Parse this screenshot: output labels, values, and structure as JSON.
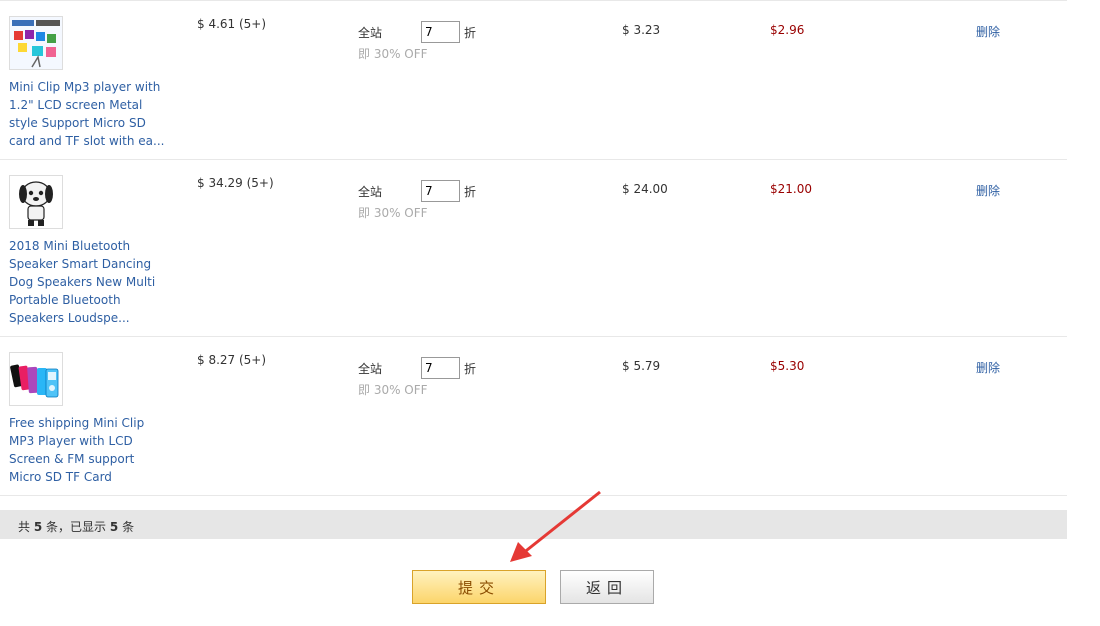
{
  "rows": [
    {
      "title": "Mini Clip Mp3 player with 1.2\" LCD screen Metal style Support Micro SD card and TF slot with ea...",
      "price": "$ 4.61 (5+)",
      "site_label": "全站",
      "discount_value": "7",
      "zhe": "折",
      "off": "即 30% OFF",
      "new_price": "$ 3.23",
      "final_price": "$2.96",
      "delete": "删除"
    },
    {
      "title": "2018 Mini Bluetooth Speaker Smart Dancing Dog Speakers New Multi Portable Bluetooth Speakers Loudspe...",
      "price": "$ 34.29 (5+)",
      "site_label": "全站",
      "discount_value": "7",
      "zhe": "折",
      "off": "即 30% OFF",
      "new_price": "$ 24.00",
      "final_price": "$21.00",
      "delete": "删除"
    },
    {
      "title": "Free shipping Mini Clip MP3 Player with LCD Screen & FM support Micro SD TF Card",
      "price": "$ 8.27 (5+)",
      "site_label": "全站",
      "discount_value": "7",
      "zhe": "折",
      "off": "即 30% OFF",
      "new_price": "$ 5.79",
      "final_price": "$5.30",
      "delete": "删除"
    }
  ],
  "footer": {
    "prefix": "共",
    "total": "5",
    "mid": "条，已显示",
    "shown": "5",
    "suffix": "条"
  },
  "buttons": {
    "submit": "提交",
    "back": "返回"
  },
  "colors": {
    "link": "#2e5fa3",
    "final_price": "#990000",
    "arrow": "#e53935"
  }
}
